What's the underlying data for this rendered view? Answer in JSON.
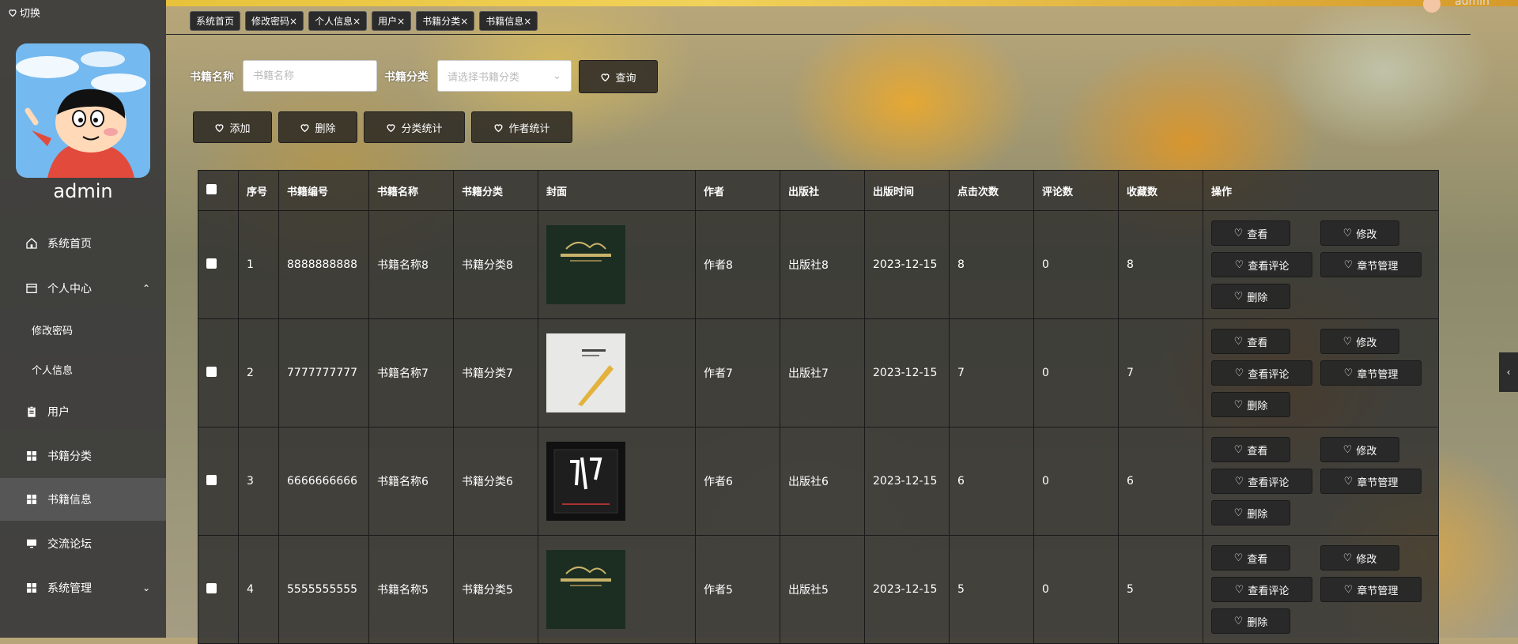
{
  "sidebar": {
    "switch_label": "切换",
    "username": "admin",
    "menu": [
      {
        "label": "系统首页",
        "icon": "home-icon"
      },
      {
        "label": "个人中心",
        "icon": "panel-icon"
      },
      {
        "label": "用户",
        "icon": "clipboard-icon"
      },
      {
        "label": "书籍分类",
        "icon": "grid-icon"
      },
      {
        "label": "书籍信息",
        "icon": "grid-icon"
      },
      {
        "label": "交流论坛",
        "icon": "monitor-icon"
      },
      {
        "label": "系统管理",
        "icon": "grid-icon"
      }
    ],
    "submenu": [
      {
        "label": "修改密码"
      },
      {
        "label": "个人信息"
      }
    ]
  },
  "header": {
    "user": "admin"
  },
  "tabs": [
    {
      "label": "系统首页"
    },
    {
      "label": "修改密码×"
    },
    {
      "label": "个人信息×"
    },
    {
      "label": "用户×"
    },
    {
      "label": "书籍分类×"
    },
    {
      "label": "书籍信息×"
    }
  ],
  "search": {
    "name_label": "书籍名称",
    "name_placeholder": "书籍名称",
    "category_label": "书籍分类",
    "category_placeholder": "请选择书籍分类",
    "query_button": "查询"
  },
  "actions": {
    "add": "添加",
    "delete": "删除",
    "category_stats": "分类统计",
    "author_stats": "作者统计"
  },
  "table": {
    "headers": [
      "序号",
      "书籍编号",
      "书籍名称",
      "书籍分类",
      "封面",
      "作者",
      "出版社",
      "出版时间",
      "点击次数",
      "评论数",
      "收藏数",
      "操作"
    ],
    "rows": [
      {
        "index": "1",
        "code": "8888888888",
        "name": "书籍名称8",
        "category": "书籍分类8",
        "cover": "dark-green-cover",
        "author": "作者8",
        "publisher": "出版社8",
        "date": "2023-12-15",
        "clicks": "8",
        "comments": "0",
        "favorites": "8"
      },
      {
        "index": "2",
        "code": "7777777777",
        "name": "书籍名称7",
        "category": "书籍分类7",
        "cover": "white-cover",
        "author": "作者7",
        "publisher": "出版社7",
        "date": "2023-12-15",
        "clicks": "7",
        "comments": "0",
        "favorites": "7"
      },
      {
        "index": "3",
        "code": "6666666666",
        "name": "书籍名称6",
        "category": "书籍分类6",
        "cover": "black-cover",
        "author": "作者6",
        "publisher": "出版社6",
        "date": "2023-12-15",
        "clicks": "6",
        "comments": "0",
        "favorites": "6"
      },
      {
        "index": "4",
        "code": "5555555555",
        "name": "书籍名称5",
        "category": "书籍分类5",
        "cover": "dark-green-cover",
        "author": "作者5",
        "publisher": "出版社5",
        "date": "2023-12-15",
        "clicks": "5",
        "comments": "0",
        "favorites": "5"
      }
    ],
    "row_actions": {
      "view": "查看",
      "edit": "修改",
      "view_comments": "查看评论",
      "chapters": "章节管理",
      "delete": "删除"
    }
  }
}
